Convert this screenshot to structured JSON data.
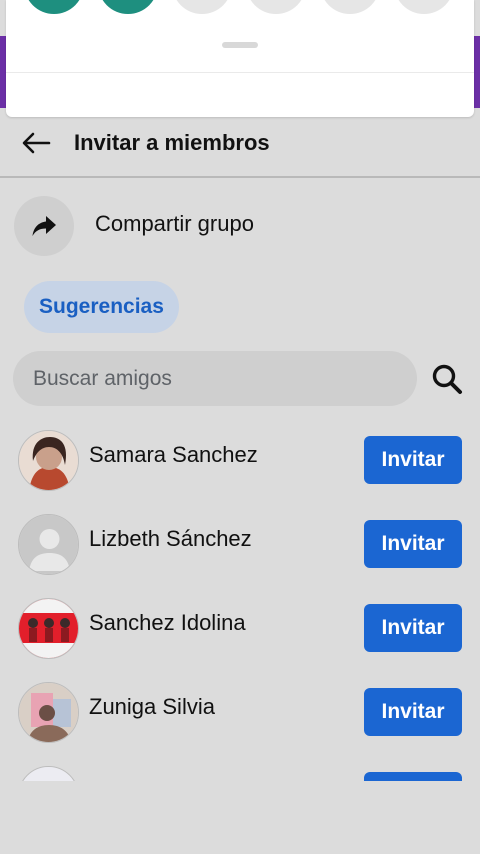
{
  "header": {
    "title": "Invitar a miembros"
  },
  "share": {
    "label": "Compartir grupo"
  },
  "chip": {
    "label": "Sugerencias"
  },
  "search": {
    "placeholder": "Buscar amigos"
  },
  "friends": [
    {
      "name": "Samara Sanchez",
      "action": "Invitar"
    },
    {
      "name": "Lizbeth Sánchez",
      "action": "Invitar"
    },
    {
      "name": "Sanchez Idolina",
      "action": "Invitar"
    },
    {
      "name": "Zuniga Silvia",
      "action": "Invitar"
    },
    {
      "name": "",
      "action": ""
    }
  ],
  "colors": {
    "accent": "#1b66d2",
    "chip_bg": "#c6d3e6",
    "chip_text": "#1a5fc2",
    "background": "#dcdcdc",
    "brand_purple": "#6b2fa6",
    "teal": "#1e8f7f"
  },
  "icons": {
    "back": "arrow-left-icon",
    "share": "share-arrow-icon",
    "search": "search-icon",
    "default_avatar": "person-icon"
  }
}
